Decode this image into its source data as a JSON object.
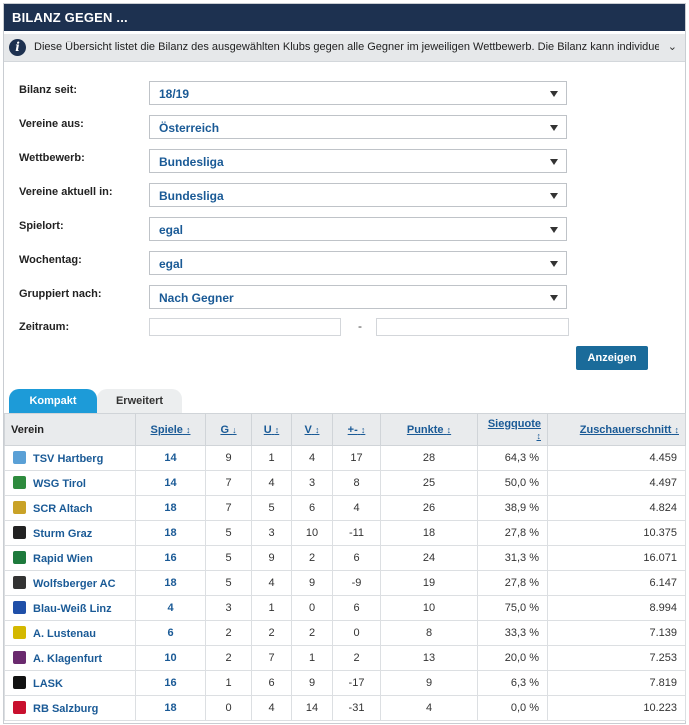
{
  "header": {
    "title": "BILANZ GEGEN ..."
  },
  "info": {
    "text": "Diese Übersicht listet die Bilanz des ausgewählten Klubs gegen alle Gegner im jeweiligen Wettbewerb. Die Bilanz kann individuell (Vereine aus…",
    "toggle": "⌄"
  },
  "filters": [
    {
      "label": "Bilanz seit:",
      "value": "18/19"
    },
    {
      "label": "Vereine aus:",
      "value": "Österreich"
    },
    {
      "label": "Wettbewerb:",
      "value": "Bundesliga"
    },
    {
      "label": "Vereine aktuell in:",
      "value": "Bundesliga"
    },
    {
      "label": "Spielort:",
      "value": "egal"
    },
    {
      "label": "Wochentag:",
      "value": "egal"
    },
    {
      "label": "Gruppiert nach:",
      "value": "Nach Gegner"
    }
  ],
  "zeitraum": {
    "label": "Zeitraum:",
    "separator": "-"
  },
  "submit_label": "Anzeigen",
  "tabs": {
    "active": "Kompakt",
    "inactive": "Erweitert"
  },
  "table": {
    "headers": {
      "verein": "Verein",
      "spiele": "Spiele",
      "g": "G",
      "u": "U",
      "v": "V",
      "diff": "+-",
      "punkte": "Punkte",
      "siegquote": "Siegquote",
      "zuschauer": "Zuschauerschnitt"
    },
    "rows": [
      {
        "club": "TSV Hartberg",
        "color": "#5aa0d6",
        "spiele": "14",
        "g": "9",
        "u": "1",
        "v": "4",
        "diff": "17",
        "punkte": "28",
        "siegquote": "64,3 %",
        "zuschauer": "4.459"
      },
      {
        "club": "WSG Tirol",
        "color": "#2e8b3e",
        "spiele": "14",
        "g": "7",
        "u": "4",
        "v": "3",
        "diff": "8",
        "punkte": "25",
        "siegquote": "50,0 %",
        "zuschauer": "4.497"
      },
      {
        "club": "SCR Altach",
        "color": "#c9a227",
        "spiele": "18",
        "g": "7",
        "u": "5",
        "v": "6",
        "diff": "4",
        "punkte": "26",
        "siegquote": "38,9 %",
        "zuschauer": "4.824"
      },
      {
        "club": "Sturm Graz",
        "color": "#222222",
        "spiele": "18",
        "g": "5",
        "u": "3",
        "v": "10",
        "diff": "-11",
        "punkte": "18",
        "siegquote": "27,8 %",
        "zuschauer": "10.375"
      },
      {
        "club": "Rapid Wien",
        "color": "#1e7a3c",
        "spiele": "16",
        "g": "5",
        "u": "9",
        "v": "2",
        "diff": "6",
        "punkte": "24",
        "siegquote": "31,3 %",
        "zuschauer": "16.071"
      },
      {
        "club": "Wolfsberger AC",
        "color": "#333333",
        "spiele": "18",
        "g": "5",
        "u": "4",
        "v": "9",
        "diff": "-9",
        "punkte": "19",
        "siegquote": "27,8 %",
        "zuschauer": "6.147"
      },
      {
        "club": "Blau-Weiß Linz",
        "color": "#1f4fa8",
        "spiele": "4",
        "g": "3",
        "u": "1",
        "v": "0",
        "diff": "6",
        "punkte": "10",
        "siegquote": "75,0 %",
        "zuschauer": "8.994"
      },
      {
        "club": "A. Lustenau",
        "color": "#d4b800",
        "spiele": "6",
        "g": "2",
        "u": "2",
        "v": "2",
        "diff": "0",
        "punkte": "8",
        "siegquote": "33,3 %",
        "zuschauer": "7.139"
      },
      {
        "club": "A. Klagenfurt",
        "color": "#6a2a6e",
        "spiele": "10",
        "g": "2",
        "u": "7",
        "v": "1",
        "diff": "2",
        "punkte": "13",
        "siegquote": "20,0 %",
        "zuschauer": "7.253"
      },
      {
        "club": "LASK",
        "color": "#111111",
        "spiele": "16",
        "g": "1",
        "u": "6",
        "v": "9",
        "diff": "-17",
        "punkte": "9",
        "siegquote": "6,3 %",
        "zuschauer": "7.819"
      },
      {
        "club": "RB Salzburg",
        "color": "#c8102e",
        "spiele": "18",
        "g": "0",
        "u": "4",
        "v": "14",
        "diff": "-31",
        "punkte": "4",
        "siegquote": "0,0 %",
        "zuschauer": "10.223"
      }
    ]
  }
}
